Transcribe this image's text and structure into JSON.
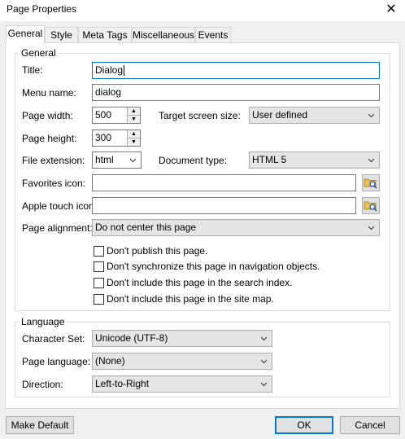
{
  "window": {
    "title": "Page Properties",
    "close_glyph": "✕"
  },
  "tabs": [
    {
      "label": "General",
      "active": true
    },
    {
      "label": "Style"
    },
    {
      "label": "Meta Tags"
    },
    {
      "label": "Miscellaneous"
    },
    {
      "label": "Events"
    }
  ],
  "general": {
    "legend": "General",
    "title_label": "Title:",
    "title_value": "Dialog",
    "menu_label": "Menu name:",
    "menu_value": "dialog",
    "width_label": "Page width:",
    "width_value": "500",
    "target_label": "Target screen size:",
    "target_value": "User defined",
    "height_label": "Page height:",
    "height_value": "300",
    "ext_label": "File extension:",
    "ext_value": "html",
    "doctype_label": "Document type:",
    "doctype_value": "HTML 5",
    "favicon_label": "Favorites icon:",
    "favicon_value": "",
    "apple_label": "Apple touch icon:",
    "apple_value": "",
    "align_label": "Page alignment:",
    "align_value": "Do not center this page",
    "checkboxes": [
      {
        "label": "Don't publish this page.",
        "checked": false
      },
      {
        "label": "Don't synchronize this page in navigation objects.",
        "checked": false
      },
      {
        "label": "Don't include this page in the search index.",
        "checked": false
      },
      {
        "label": "Don't include this page in the site map.",
        "checked": false
      }
    ]
  },
  "language": {
    "legend": "Language",
    "charset_label": "Character Set:",
    "charset_value": "Unicode (UTF-8)",
    "lang_label": "Page language:",
    "lang_value": "(None)",
    "dir_label": "Direction:",
    "dir_value": "Left-to-Right"
  },
  "footer": {
    "make_default": "Make Default",
    "ok": "OK",
    "cancel": "Cancel"
  },
  "icons": {
    "browse": "folder-search-icon",
    "dropdown": "chevron-down-icon",
    "spin_up": "▲",
    "spin_down": "▼"
  },
  "colors": {
    "accent": "#0078d7",
    "face": "#f0f0f0"
  }
}
